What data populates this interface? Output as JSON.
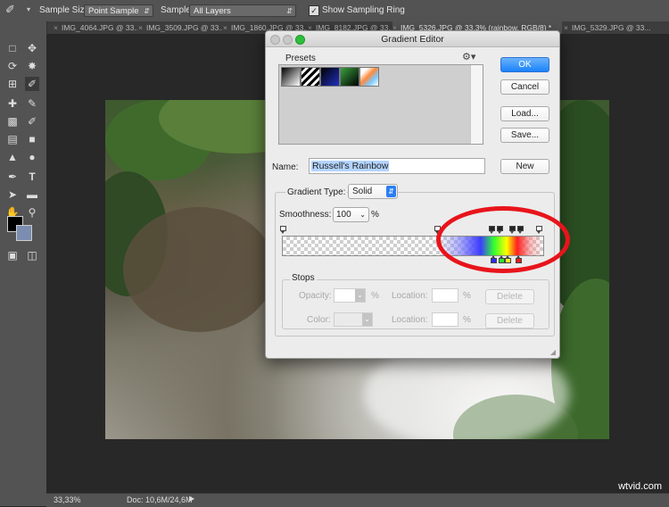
{
  "options_bar": {
    "sample_size_label": "Sample Size:",
    "sample_size_value": "Point Sample",
    "sample_label": "Sample:",
    "sample_value": "All Layers",
    "show_ring_label": "Show Sampling Ring",
    "show_ring_checked": true
  },
  "tabs": [
    {
      "label": "IMG_4064.JPG @ 33..."
    },
    {
      "label": "IMG_3509.JPG @ 33..."
    },
    {
      "label": "IMG_1860.JPG @ 33..."
    },
    {
      "label": "IMG_8182.JPG @ 33..."
    },
    {
      "label": "IMG_5326.JPG @ 33.3% (rainbow, RGB/8) *"
    },
    {
      "label": "IMG_5329.JPG @ 33..."
    }
  ],
  "status": {
    "zoom": "33,33%",
    "doc": "Doc: 10,6M/24,6M"
  },
  "dialog": {
    "title": "Gradient Editor",
    "presets_label": "Presets",
    "ok_label": "OK",
    "cancel_label": "Cancel",
    "load_label": "Load...",
    "save_label": "Save...",
    "name_label": "Name:",
    "name_value": "Russell's Rainbow",
    "new_label": "New",
    "gradient_type_label": "Gradient Type:",
    "gradient_type_value": "Solid",
    "smoothness_label": "Smoothness:",
    "smoothness_value": "100",
    "smoothness_unit": "%",
    "stops_label": "Stops",
    "opacity_label": "Opacity:",
    "opacity_unit": "%",
    "location_label": "Location:",
    "location_unit": "%",
    "color_label": "Color:",
    "delete_label": "Delete"
  },
  "watermark": "wtvid.com"
}
